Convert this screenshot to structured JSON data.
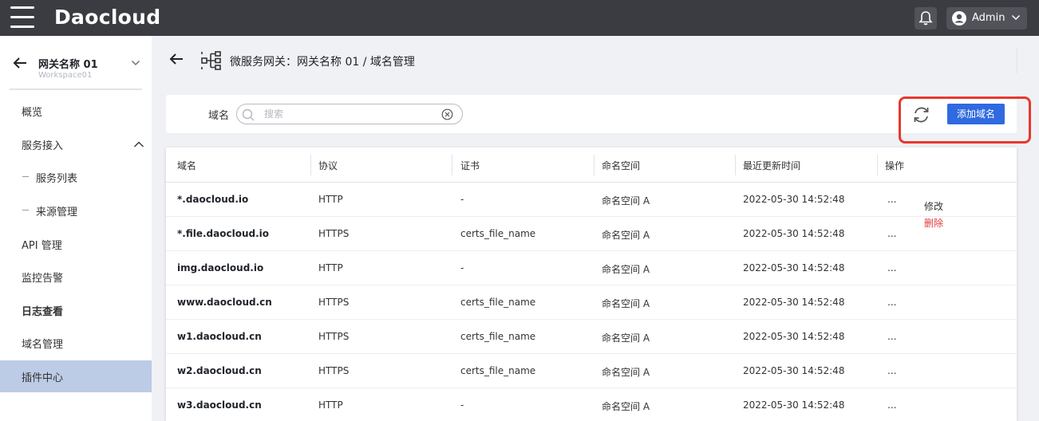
{
  "topbar": {
    "brand": "Daocloud",
    "user": "Admin"
  },
  "sidebar": {
    "workspace_name": "网关名称 01",
    "workspace_sub": "Workspace01",
    "items": [
      {
        "label": "概览"
      },
      {
        "label": "服务接入"
      },
      {
        "label": "服务列表"
      },
      {
        "label": "来源管理"
      },
      {
        "label": "API 管理"
      },
      {
        "label": "监控告警"
      },
      {
        "label": "日志查看"
      },
      {
        "label": "域名管理"
      },
      {
        "label": "插件中心"
      }
    ]
  },
  "page": {
    "title": "微服务网关：网关名称 01 / 域名管理"
  },
  "filter": {
    "label": "域名",
    "placeholder": "搜索",
    "add_label": "添加域名"
  },
  "table": {
    "headers": [
      "域名",
      "协议",
      "证书",
      "命名空间",
      "最近更新时间",
      "操作"
    ],
    "rows": [
      {
        "domain": "*.daocloud.io",
        "protocol": "HTTP",
        "cert": "-",
        "ns": "命名空间 A",
        "time": "2022-05-30 14:52:48",
        "op": "..."
      },
      {
        "domain": "*.file.daocloud.io",
        "protocol": "HTTPS",
        "cert": "certs_file_name",
        "ns": "命名空间 A",
        "time": "2022-05-30 14:52:48",
        "op": "..."
      },
      {
        "domain": "img.daocloud.io",
        "protocol": "HTTP",
        "cert": "-",
        "ns": "命名空间 A",
        "time": "2022-05-30 14:52:48",
        "op": "..."
      },
      {
        "domain": "www.daocloud.cn",
        "protocol": "HTTPS",
        "cert": "certs_file_name",
        "ns": "命名空间 A",
        "time": "2022-05-30 14:52:48",
        "op": "..."
      },
      {
        "domain": "w1.daocloud.cn",
        "protocol": "HTTPS",
        "cert": "certs_file_name",
        "ns": "命名空间 A",
        "time": "2022-05-30 14:52:48",
        "op": "..."
      },
      {
        "domain": "w2.daocloud.cn",
        "protocol": "HTTPS",
        "cert": "certs_file_name",
        "ns": "命名空间 A",
        "time": "2022-05-30 14:52:48",
        "op": "..."
      },
      {
        "domain": "w3.daocloud.cn",
        "protocol": "HTTP",
        "cert": "-",
        "ns": "命名空间 A",
        "time": "2022-05-30 14:52:48",
        "op": "..."
      }
    ]
  },
  "row_menu": {
    "edit": "修改",
    "delete": "删除"
  },
  "colors": {
    "primary": "#2f6ae0",
    "topbar": "#3b3c41",
    "active_nav": "#bccbe6",
    "danger": "#e23c3c",
    "highlight": "#e8382c"
  }
}
